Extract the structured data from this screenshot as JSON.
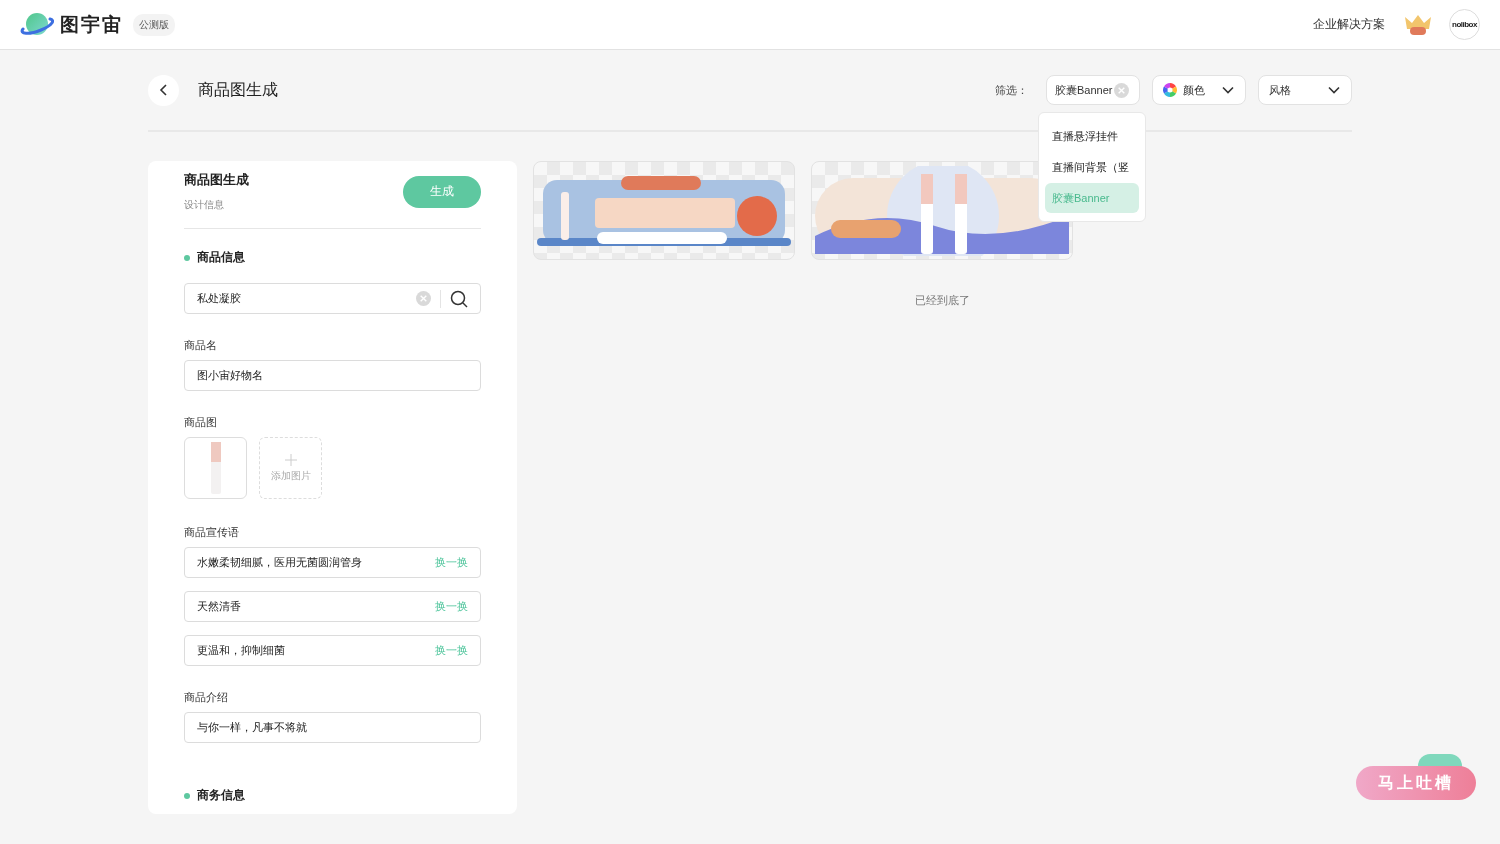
{
  "header": {
    "logo_text": "图宇宙",
    "badge": "公测版",
    "enterprise_link": "企业解决方案",
    "avatar_text": "nolibox"
  },
  "toolbar": {
    "title": "商品图生成",
    "filter_label": "筛选：",
    "filter_chip": "胶囊Banner",
    "color_select": "颜色",
    "style_select": "风格",
    "menu": [
      {
        "label": "直播悬浮挂件",
        "selected": false
      },
      {
        "label": "直播间背景（竖",
        "selected": false
      },
      {
        "label": "胶囊Banner",
        "selected": true
      }
    ]
  },
  "panel": {
    "title": "商品图生成",
    "subtitle": "设计信息",
    "generate_button": "生成",
    "product_section": "商品信息",
    "search_value": "私处凝胶",
    "name_label": "商品名",
    "name_value": "图小宙好物名",
    "image_label": "商品图",
    "add_image": "添加图片",
    "slogan_label": "商品宣传语",
    "slogans": [
      {
        "value": "水嫩柔韧细腻，医用无菌圆润管身",
        "action": "换一换"
      },
      {
        "value": "天然清香",
        "action": "换一换"
      },
      {
        "value": "更温和，抑制细菌",
        "action": "换一换"
      }
    ],
    "intro_label": "商品介绍",
    "intro_value": "与你一样，凡事不将就",
    "business_section": "商务信息"
  },
  "results": {
    "cards": [
      {
        "kind": "blue"
      },
      {
        "kind": "purple"
      }
    ],
    "end_text": "已经到底了"
  },
  "feedback_button": "马上吐槽"
}
